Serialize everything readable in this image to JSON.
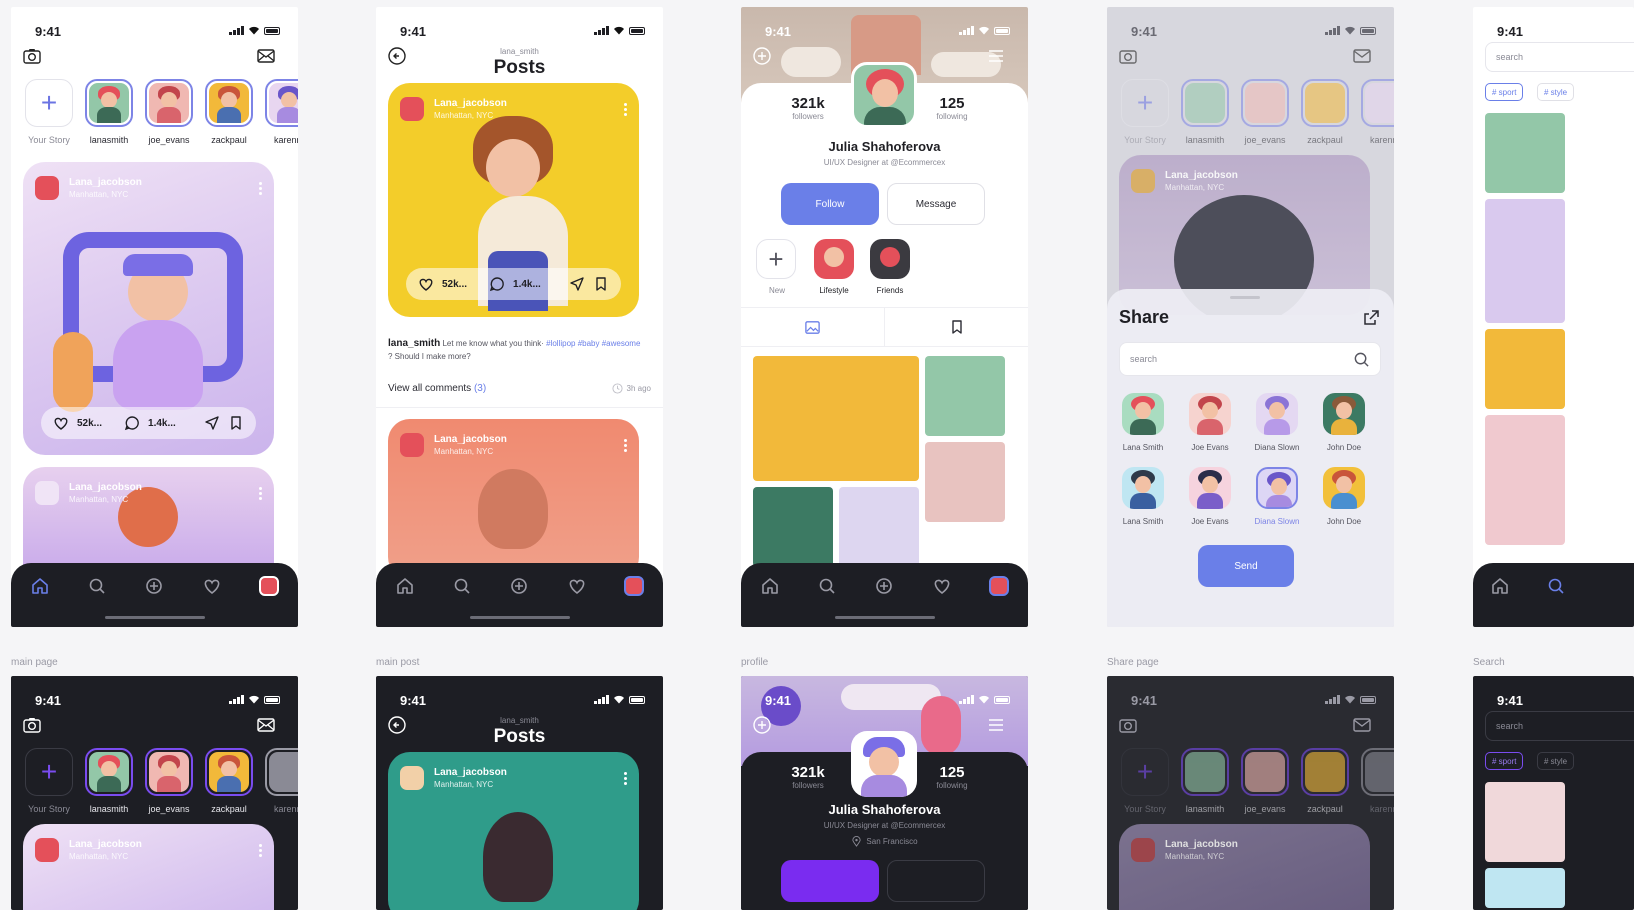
{
  "status": {
    "time": "9:41"
  },
  "colors": {
    "accent": "#6a7fe8",
    "dark_bg": "#1d1e24",
    "purple": "#7a4cf0"
  },
  "stories": [
    {
      "name": "Your Story",
      "add": true
    },
    {
      "name": "lanasmith",
      "bg": "#93c7a8",
      "hair": "#e4505a",
      "body": "#3c6a56"
    },
    {
      "name": "joe_evans",
      "bg": "#f0b8b2",
      "hair": "#c2454c",
      "body": "#d9646c"
    },
    {
      "name": "zackpaul",
      "bg": "#f2b93a",
      "hair": "#c9553a",
      "body": "#4a6fb0"
    },
    {
      "name": "karenm",
      "bg": "#e8d6f0",
      "hair": "#6a56c9",
      "body": "#a78be0"
    }
  ],
  "post": {
    "author": "Lana_jacobson",
    "location": "Manhattan, NYC",
    "likes": "52k...",
    "comments": "1.4k..."
  },
  "posts_screen": {
    "username": "lana_smith",
    "title": "Posts",
    "caption_user": "lana_smith",
    "caption_text": "Let me know what you think·",
    "hashtags_1": "#lollipop #baby",
    "hashtags_2": "#awesome",
    "caption_tail": "? Should I make more?",
    "view_comments": "View all comments",
    "comment_count": "(3)",
    "time_ago": "3h ago"
  },
  "profile": {
    "followers_count": "321k",
    "followers_label": "followers",
    "following_count": "125",
    "following_label": "following",
    "name": "Julia Shahoferova",
    "role": "UI/UX Designer at @Ecommercex",
    "location": "San Francisco",
    "follow": "Follow",
    "message": "Message",
    "highlights": [
      "New",
      "Lifestyle",
      "Friends"
    ]
  },
  "share": {
    "title": "Share",
    "search_placeholder": "search",
    "people": [
      {
        "name": "Lana Smith",
        "bg": "#a9dcc0",
        "hair": "#e4505a",
        "body": "#3c6a56"
      },
      {
        "name": "Joe Evans",
        "bg": "#f6d3cf",
        "hair": "#c2454c",
        "body": "#d9646c"
      },
      {
        "name": "Diana Slown",
        "bg": "#e4d8f2",
        "hair": "#8b74d6",
        "body": "#b79ae8"
      },
      {
        "name": "John Doe",
        "bg": "#3c7a63",
        "hair": "#8a5a3a",
        "body": "#e9b23c"
      },
      {
        "name": "Lana Smith",
        "bg": "#bfe6f2",
        "hair": "#2e3a4a",
        "body": "#3a5fa0"
      },
      {
        "name": "Joe Evans",
        "bg": "#f6d3de",
        "hair": "#2b2d4a",
        "body": "#7a5ec9"
      },
      {
        "name": "Diana Slown",
        "bg": "#ddd6f5",
        "hair": "#6a56c9",
        "body": "#a78be0",
        "selected": true
      },
      {
        "name": "John Doe",
        "bg": "#f2c03a",
        "hair": "#c9553a",
        "body": "#4a8fd0"
      }
    ],
    "send": "Send"
  },
  "search_screen": {
    "placeholder": "search",
    "tags": [
      "# sport",
      "# style"
    ]
  },
  "captions": [
    "main page",
    "main post",
    "profile",
    "Share page",
    "Search"
  ]
}
